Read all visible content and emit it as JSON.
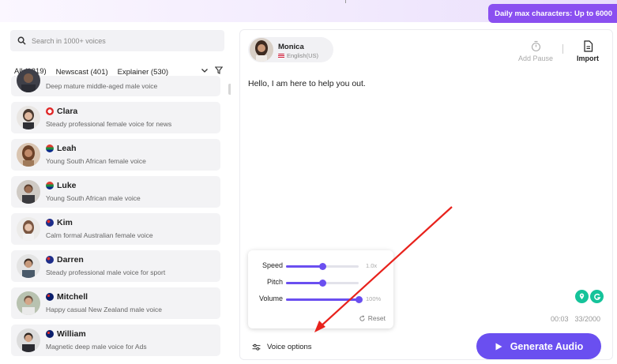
{
  "header": {
    "max_chars_label": "Daily max characters: Up to 6000"
  },
  "colors": {
    "accent": "#6a4ff0",
    "badge": "#8a4ff0",
    "arrow": "#e8221c",
    "grammarly_green": "#15c39a"
  },
  "sidebar": {
    "search": {
      "placeholder": "Search in 1000+ voices"
    },
    "tabs": [
      {
        "label": "All (1219)",
        "active": true
      },
      {
        "label": "Newscast (401)"
      },
      {
        "label": "Explainer (530)"
      }
    ],
    "voices": [
      {
        "name": "",
        "desc": "Deep mature middle-aged male voice",
        "flag": ""
      },
      {
        "name": "Clara",
        "desc": "Steady professional female voice for news",
        "flag": "canada-flag"
      },
      {
        "name": "Leah",
        "desc": "Young South African female voice",
        "flag": "south-africa-flag"
      },
      {
        "name": "Luke",
        "desc": "Young South African male voice",
        "flag": "south-africa-flag"
      },
      {
        "name": "Kim",
        "desc": "Calm formal Australian female voice",
        "flag": "australia-flag"
      },
      {
        "name": "Darren",
        "desc": "Steady professional male voice for sport",
        "flag": "australia-flag"
      },
      {
        "name": "Mitchell",
        "desc": "Happy casual New Zealand male voice",
        "flag": "new-zealand-flag"
      },
      {
        "name": "William",
        "desc": "Magnetic deep male voice for Ads",
        "flag": "new-zealand-flag"
      }
    ]
  },
  "editor": {
    "speaker": {
      "name": "Monica",
      "language": "English(US)"
    },
    "toolbar": {
      "add_pause": "Add Pause",
      "import": "Import"
    },
    "text": "Hello, I am here to help you out.",
    "duration": "00:03",
    "char_count": "33/2000",
    "voice_options": {
      "speed": {
        "label": "Speed",
        "value": "1.0x",
        "level": 0.5
      },
      "pitch": {
        "label": "Pitch",
        "value": "",
        "level": 0.5
      },
      "volume": {
        "label": "Volume",
        "value": "100%",
        "level": 1.0
      },
      "reset_label": "Reset"
    },
    "voice_options_label": "Voice options",
    "generate_label": "Generate Audio"
  }
}
